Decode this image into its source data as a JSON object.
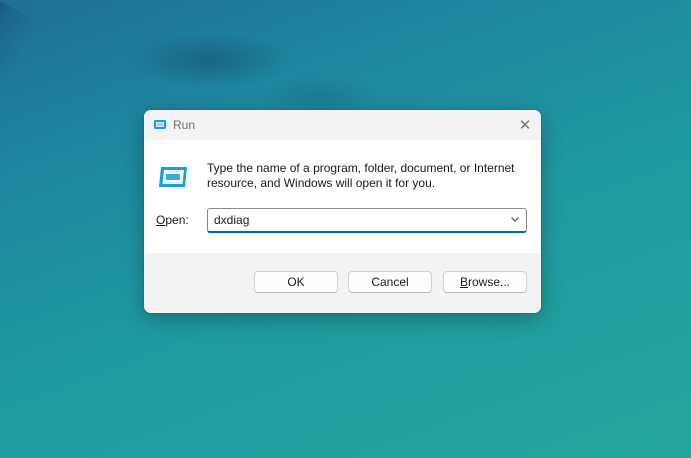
{
  "dialog": {
    "title": "Run",
    "close_symbol": "✕",
    "description": "Type the name of a program, folder, document, or Internet resource, and Windows will open it for you.",
    "open_label_accel": "O",
    "open_label_rest": "pen:",
    "input_value": "dxdiag",
    "buttons": {
      "ok": "OK",
      "cancel": "Cancel",
      "browse_accel": "B",
      "browse_rest": "rowse..."
    }
  },
  "icons": {
    "title": "run-icon",
    "main": "run-icon",
    "dropdown": "chevron-down-icon",
    "close": "close-icon"
  },
  "colors": {
    "accent": "#0067c0",
    "icon_blue": "#1f9bd6"
  }
}
